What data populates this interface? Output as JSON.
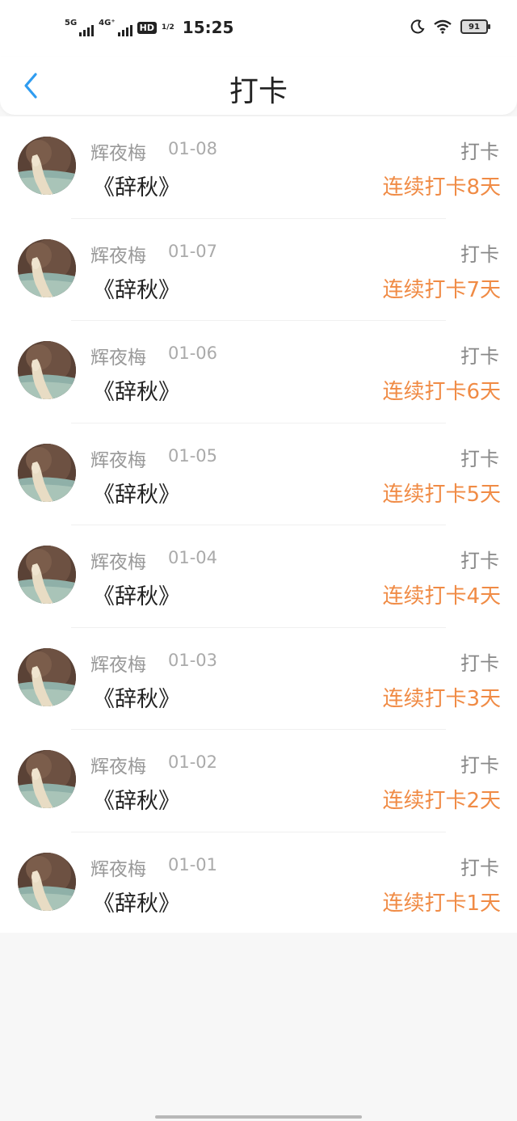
{
  "status_bar": {
    "network_1": "5G",
    "network_2": "4G⁺",
    "hd_label": "HD",
    "hd_sub": "1/2",
    "time": "15:25",
    "battery": "91",
    "icons": [
      "moon-icon",
      "wifi-icon",
      "battery-icon"
    ]
  },
  "nav": {
    "title": "打卡",
    "back_icon": "chevron-left-icon",
    "accent_color": "#2f9cf0"
  },
  "colors": {
    "streak": "#f08b45",
    "meta": "#999999",
    "book": "#222222"
  },
  "checkins": [
    {
      "name": "辉夜梅",
      "date": "01-08",
      "book": "《辞秋》",
      "action": "打卡",
      "streak": "连续打卡8天"
    },
    {
      "name": "辉夜梅",
      "date": "01-07",
      "book": "《辞秋》",
      "action": "打卡",
      "streak": "连续打卡7天"
    },
    {
      "name": "辉夜梅",
      "date": "01-06",
      "book": "《辞秋》",
      "action": "打卡",
      "streak": "连续打卡6天"
    },
    {
      "name": "辉夜梅",
      "date": "01-05",
      "book": "《辞秋》",
      "action": "打卡",
      "streak": "连续打卡5天"
    },
    {
      "name": "辉夜梅",
      "date": "01-04",
      "book": "《辞秋》",
      "action": "打卡",
      "streak": "连续打卡4天"
    },
    {
      "name": "辉夜梅",
      "date": "01-03",
      "book": "《辞秋》",
      "action": "打卡",
      "streak": "连续打卡3天"
    },
    {
      "name": "辉夜梅",
      "date": "01-02",
      "book": "《辞秋》",
      "action": "打卡",
      "streak": "连续打卡2天"
    },
    {
      "name": "辉夜梅",
      "date": "01-01",
      "book": "《辞秋》",
      "action": "打卡",
      "streak": "连续打卡1天"
    }
  ]
}
